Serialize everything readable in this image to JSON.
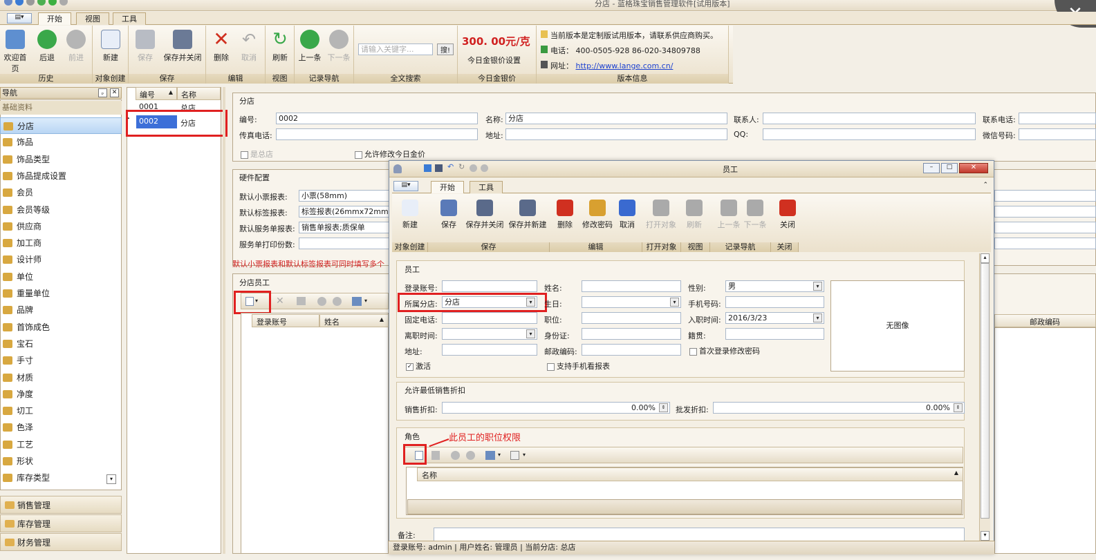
{
  "window": {
    "title": "分店 - 蓝格珠宝销售管理软件[试用版本]"
  },
  "tabs": [
    "开始",
    "视图",
    "工具"
  ],
  "ribbon": {
    "history": {
      "label": "历史",
      "buttons": [
        "欢迎首页",
        "后退",
        "前进"
      ]
    },
    "create": {
      "label": "对象创建",
      "buttons": [
        "新建"
      ]
    },
    "save": {
      "label": "保存",
      "buttons": [
        "保存",
        "保存并关闭"
      ]
    },
    "edit": {
      "label": "编辑",
      "buttons": [
        "删除",
        "取消"
      ]
    },
    "view": {
      "label": "视图",
      "buttons": [
        "刷新"
      ]
    },
    "recnav": {
      "label": "记录导航",
      "buttons": [
        "上一条",
        "下一条"
      ]
    },
    "search": {
      "label": "全文搜索",
      "placeholder": "请输入关键字...",
      "btn": "搜!"
    },
    "gold": {
      "label": "今日金银价",
      "price": "300. 00元/克",
      "setting": "今日金银价设置"
    },
    "version": {
      "label": "版本信息",
      "line1": "当前版本是定制版试用版本，请联系供应商购买。",
      "line2": "电话： 400-0505-928  86-020-34809788",
      "line3": "网址：",
      "url": "http://www.lange.com.cn/"
    }
  },
  "nav": {
    "title": "导航",
    "section": "基础资料",
    "items": [
      "分店",
      "饰品",
      "饰品类型",
      "饰品提成设置",
      "会员",
      "会员等级",
      "供应商",
      "加工商",
      "设计师",
      "单位",
      "重量单位",
      "品牌",
      "首饰成色",
      "宝石",
      "手寸",
      "材质",
      "净度",
      "切工",
      "色泽",
      "工艺",
      "形状",
      "库存类型"
    ],
    "groups": [
      "销售管理",
      "库存管理",
      "财务管理"
    ]
  },
  "list": {
    "cols": [
      "编号",
      "名称"
    ],
    "rows": [
      [
        "0001",
        "总店"
      ],
      [
        "0002",
        "分店"
      ]
    ]
  },
  "store": {
    "section": "分店",
    "code_label": "编号:",
    "code": "0002",
    "name_label": "名称:",
    "name": "分店",
    "contact_label": "联系人:",
    "phone_label": "联系电话:",
    "fax_label": "传真电话:",
    "addr_label": "地址:",
    "qq_label": "QQ:",
    "wechat_label": "微信号码:",
    "is_main": "是总店",
    "allow_edit": "允许修改今日金价"
  },
  "hardware": {
    "section": "硬件配置",
    "receipt_label": "默认小票报表:",
    "receipt": "小票(58mm)",
    "tag_label": "默认标签报表:",
    "tag": "标签报表(26mmx72mm)",
    "service_label": "默认服务单报表:",
    "service": "销售单报表;质保单",
    "copies_label": "服务单打印份数:",
    "note": "默认小票报表和默认标签报表可同时填写多个"
  },
  "staff": {
    "section": "分店员工",
    "cols": [
      "登录账号",
      "姓名"
    ],
    "col_right": "邮政编码"
  },
  "dialog": {
    "title": "员工",
    "tabs": [
      "开始",
      "工具"
    ],
    "groups": {
      "create": "对象创建",
      "save": "保存",
      "edit": "编辑",
      "open": "打开对象",
      "view": "视图",
      "recnav": "记录导航",
      "close": "关闭"
    },
    "buttons": [
      "新建",
      "保存",
      "保存并关闭",
      "保存并新建",
      "删除",
      "修改密码",
      "取消",
      "打开对象",
      "刷新",
      "上一条",
      "下一条",
      "关闭"
    ],
    "emp_section": "员工",
    "login_label": "登录账号:",
    "name_label": "姓名:",
    "gender_label": "性别:",
    "gender": "男",
    "branch_label": "所属分店:",
    "branch": "分店",
    "birthday_label": "生日:",
    "mobile_label": "手机号码:",
    "tel_label": "固定电话:",
    "position_label": "职位:",
    "hire_label": "入职时间:",
    "hire": "2016/3/23",
    "leave_label": "离职时间:",
    "idcard_label": "身份证:",
    "native_label": "籍贯:",
    "addr_label": "地址:",
    "zip_label": "邮政编码:",
    "first_login": "首次登录修改密码",
    "active": "激活",
    "mobile_report": "支持手机看报表",
    "no_image": "无图像",
    "discount_section": "允许最低销售折扣",
    "sale_disc_label": "销售折扣:",
    "sale_disc": "0.00%",
    "whole_disc_label": "批发折扣:",
    "whole_disc": "0.00%",
    "role_section": "角色",
    "role_note": "此员工的职位权限",
    "role_col": "名称",
    "remark_label": "备注:"
  },
  "status": {
    "text": "登录账号: admin  |  用户姓名: 管理员  |  当前分店: 总店"
  }
}
